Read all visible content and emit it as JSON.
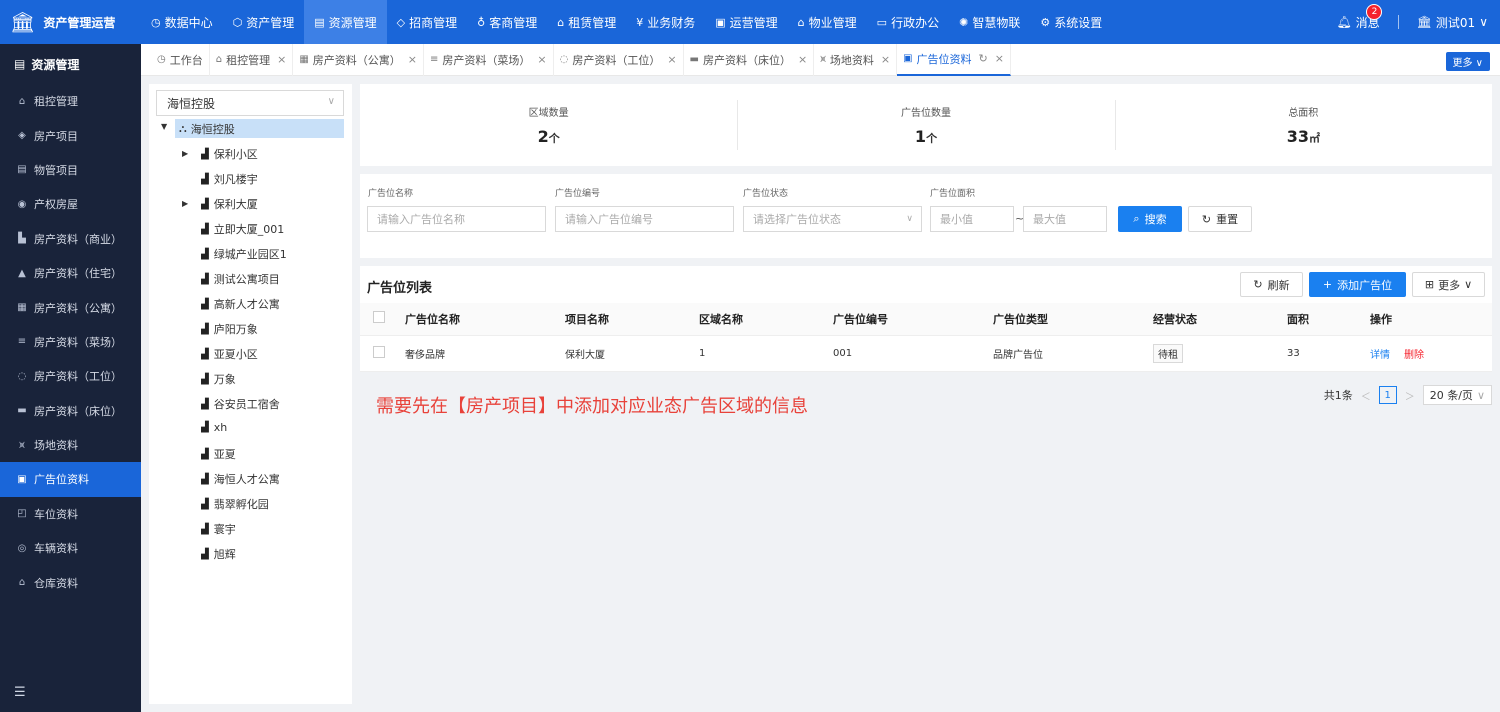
{
  "app": {
    "title": "资产管理运营"
  },
  "topnav": [
    {
      "label": "数据中心",
      "icon": "◷"
    },
    {
      "label": "资产管理",
      "icon": "⬡"
    },
    {
      "label": "资源管理",
      "icon": "▤"
    },
    {
      "label": "招商管理",
      "icon": "◇"
    },
    {
      "label": "客商管理",
      "icon": "♁"
    },
    {
      "label": "租赁管理",
      "icon": "⌂"
    },
    {
      "label": "业务财务",
      "icon": "¥"
    },
    {
      "label": "运营管理",
      "icon": "▣"
    },
    {
      "label": "物业管理",
      "icon": "⌂"
    },
    {
      "label": "行政办公",
      "icon": "▭"
    },
    {
      "label": "智慧物联",
      "icon": "✺"
    },
    {
      "label": "系统设置",
      "icon": "⚙"
    }
  ],
  "header_right": {
    "message_label": "消息",
    "message_count": "2",
    "user_name": "测试01"
  },
  "sidebar": {
    "title": "资源管理",
    "items": [
      {
        "label": "租控管理",
        "icon": "⌂"
      },
      {
        "label": "房产项目",
        "icon": "◈"
      },
      {
        "label": "物管项目",
        "icon": "▤"
      },
      {
        "label": "产权房屋",
        "icon": "◉"
      },
      {
        "label": "房产资料（商业）",
        "icon": "▙"
      },
      {
        "label": "房产资料（住宅）",
        "icon": "▲"
      },
      {
        "label": "房产资料（公寓）",
        "icon": "▦"
      },
      {
        "label": "房产资料（菜场）",
        "icon": "≡"
      },
      {
        "label": "房产资料（工位）",
        "icon": "◌"
      },
      {
        "label": "房产资料（床位）",
        "icon": "▬"
      },
      {
        "label": "场地资料",
        "icon": "⩙"
      },
      {
        "label": "广告位资料",
        "icon": "▣"
      },
      {
        "label": "车位资料",
        "icon": "◰"
      },
      {
        "label": "车辆资料",
        "icon": "◎"
      },
      {
        "label": "仓库资料",
        "icon": "⌂"
      }
    ],
    "active_index": 11
  },
  "tabs": [
    {
      "label": "工作台",
      "icon": "◷",
      "closable": false
    },
    {
      "label": "租控管理",
      "icon": "⌂",
      "closable": true
    },
    {
      "label": "房产资料（公寓）",
      "icon": "▦",
      "closable": true
    },
    {
      "label": "房产资料（菜场）",
      "icon": "≡",
      "closable": true
    },
    {
      "label": "房产资料（工位）",
      "icon": "◌",
      "closable": true
    },
    {
      "label": "房产资料（床位）",
      "icon": "▬",
      "closable": true
    },
    {
      "label": "场地资料",
      "icon": "⩙",
      "closable": true
    },
    {
      "label": "广告位资料",
      "icon": "▣",
      "closable": true
    }
  ],
  "tabs_more": "更多",
  "tree": {
    "select_value": "海恒控股",
    "root": "海恒控股",
    "nodes": [
      {
        "label": "保利小区",
        "expandable": true
      },
      {
        "label": "刘凡楼宇",
        "expandable": false
      },
      {
        "label": "保利大厦",
        "expandable": true
      },
      {
        "label": "立即大厦_001",
        "expandable": false
      },
      {
        "label": "绿城产业园区1",
        "expandable": false
      },
      {
        "label": "测试公寓项目",
        "expandable": false
      },
      {
        "label": "高新人才公寓",
        "expandable": false
      },
      {
        "label": "庐阳万象",
        "expandable": false
      },
      {
        "label": "亚夏小区",
        "expandable": false
      },
      {
        "label": "万象",
        "expandable": false
      },
      {
        "label": "谷安员工宿舍",
        "expandable": false
      },
      {
        "label": "xh",
        "expandable": false
      },
      {
        "label": "亚夏",
        "expandable": false
      },
      {
        "label": "海恒人才公寓",
        "expandable": false
      },
      {
        "label": "翡翠孵化园",
        "expandable": false
      },
      {
        "label": "寰宇",
        "expandable": false
      },
      {
        "label": "旭辉",
        "expandable": false
      }
    ]
  },
  "stats": [
    {
      "label": "区域数量",
      "value": "2",
      "unit": "个"
    },
    {
      "label": "广告位数量",
      "value": "1",
      "unit": "个"
    },
    {
      "label": "总面积",
      "value": "33",
      "unit": "㎡"
    }
  ],
  "filters": {
    "name_label": "广告位名称",
    "name_placeholder": "请输入广告位名称",
    "code_label": "广告位编号",
    "code_placeholder": "请输入广告位编号",
    "status_label": "广告位状态",
    "status_placeholder": "请选择广告位状态",
    "area_label": "广告位面积",
    "area_min_placeholder": "最小值",
    "area_max_placeholder": "最大值",
    "area_sep": "~",
    "search_label": "搜索",
    "reset_label": "重置"
  },
  "list": {
    "title": "广告位列表",
    "refresh_label": "刷新",
    "add_label": "添加广告位",
    "more_label": "更多",
    "columns": [
      "广告位名称",
      "项目名称",
      "区域名称",
      "广告位编号",
      "广告位类型",
      "经营状态",
      "面积",
      "操作"
    ],
    "rows": [
      {
        "name": "奢侈品牌",
        "project": "保利大厦",
        "region": "1",
        "code": "001",
        "type": "品牌广告位",
        "status": "待租",
        "area": "33",
        "detail": "详情",
        "delete": "删除"
      }
    ]
  },
  "notice": "需要先在【房产项目】中添加对应业态广告区域的信息",
  "pagination": {
    "total_text": "共1条",
    "current_page": "1",
    "page_size": "20 条/页"
  }
}
